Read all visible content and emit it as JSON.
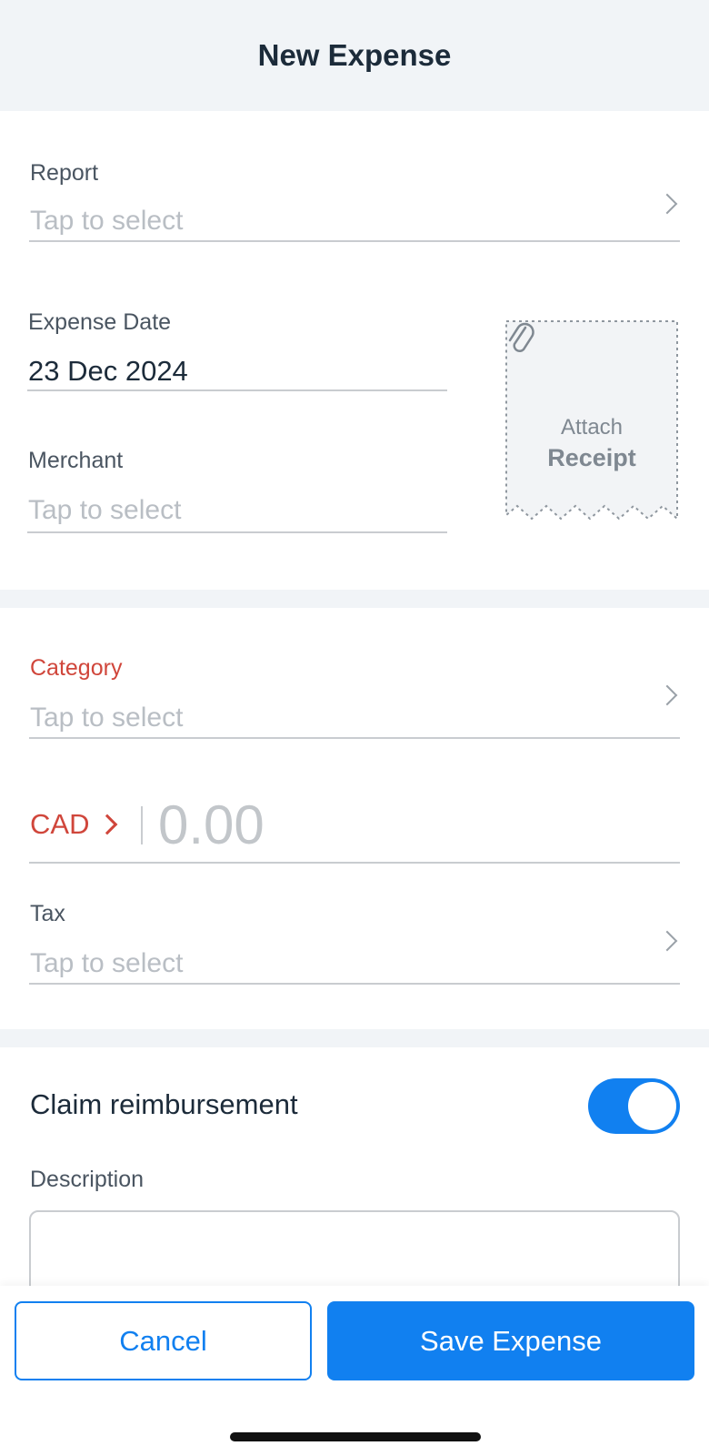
{
  "header": {
    "title": "New Expense"
  },
  "report": {
    "label": "Report",
    "placeholder": "Tap to select"
  },
  "expense_date": {
    "label": "Expense Date",
    "value": "23 Dec 2024"
  },
  "merchant": {
    "label": "Merchant",
    "placeholder": "Tap to select"
  },
  "receipt": {
    "attach": "Attach",
    "receipt": "Receipt",
    "icon": "paperclip-icon"
  },
  "category": {
    "label": "Category",
    "placeholder": "Tap to select"
  },
  "amount": {
    "currency": "CAD",
    "value": "0.00"
  },
  "tax": {
    "label": "Tax",
    "placeholder": "Tap to select"
  },
  "claim": {
    "label": "Claim reimbursement",
    "enabled": true
  },
  "description": {
    "label": "Description",
    "value": ""
  },
  "footer": {
    "cancel_label": "Cancel",
    "save_label": "Save Expense"
  },
  "colors": {
    "accent": "#1180f0",
    "required": "#d0463b"
  }
}
